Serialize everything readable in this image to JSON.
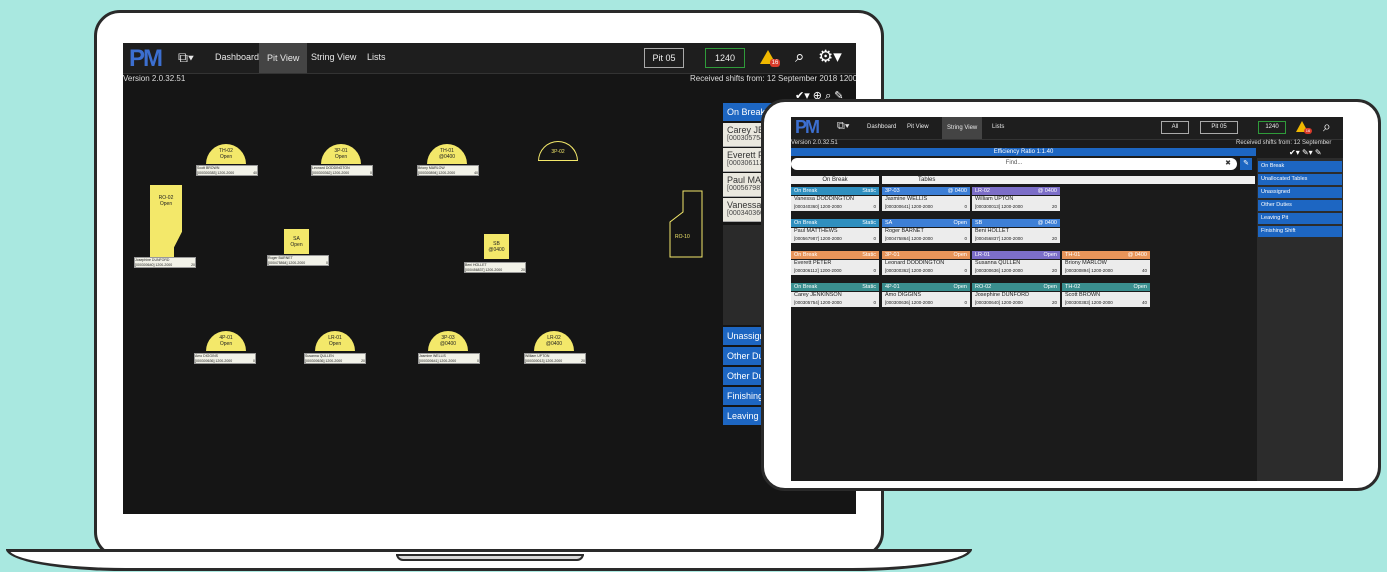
{
  "laptop": {
    "nav": {
      "logo": "PM",
      "dashboard": "Dashboard",
      "pit_view": "Pit View",
      "string_view": "String View",
      "lists": "Lists",
      "pit": "Pit 05",
      "count": "1240",
      "warn_badge": "16"
    },
    "version": "Version 2.0.32.51",
    "received": "Received shifts from: 12 September 2018 1200",
    "tables": [
      {
        "code": "TH-02",
        "status": "Open",
        "dealer": "Scott BROWN",
        "meta": "[000300383] 1200-2000",
        "num": "40"
      },
      {
        "code": "3P-01",
        "status": "Open",
        "dealer": "Leonard DODDINGTON",
        "meta": "[000300362] 1200-2000",
        "num": "0"
      },
      {
        "code": "TH-01",
        "status": "@0400",
        "dealer": "Briony MARLOW",
        "meta": "[000300894] 1200-2000",
        "num": "40"
      },
      {
        "code": "3P-02",
        "status": "",
        "dealer": "",
        "meta": "",
        "num": ""
      },
      {
        "code": "RO-02",
        "status": "Open",
        "dealer": "Josephine DUNFORD",
        "meta": "[000300640] 1200-2000",
        "num": "20"
      },
      {
        "code": "SA",
        "status": "Open",
        "dealer": "Roger BARNET",
        "meta": "[000475864] 1200-2000",
        "num": "0"
      },
      {
        "code": "SB",
        "status": "@0400",
        "dealer": "Beni HOLLET",
        "meta": "[000456837] 1200-2000",
        "num": "20"
      },
      {
        "code": "RO-10",
        "status": "",
        "dealer": "",
        "meta": "",
        "num": ""
      },
      {
        "code": "4P-01",
        "status": "Open",
        "dealer": "Amo DIGGINS",
        "meta": "[000300636] 1200-2000",
        "num": "0"
      },
      {
        "code": "LR-01",
        "status": "Open",
        "dealer": "Susanna QULLEN",
        "meta": "[000300636] 1200-2000",
        "num": "20"
      },
      {
        "code": "3P-03",
        "status": "@0400",
        "dealer": "Jasmine WELLIS",
        "meta": "[000300641] 1200-2000",
        "num": "0"
      },
      {
        "code": "LR-02",
        "status": "@0400",
        "dealer": "William UPTON",
        "meta": "[000300013] 1200-2000",
        "num": "20"
      }
    ],
    "panel": {
      "on_break": "On Break",
      "cards": [
        {
          "name": "Carey JE",
          "meta": "[000305754]"
        },
        {
          "name": "Everett P",
          "meta": "[000306112]"
        },
        {
          "name": "Paul MAT",
          "meta": "[000567987]"
        },
        {
          "name": "Vanessa",
          "meta": "[000340360]"
        }
      ],
      "buttons": [
        "Unassigned",
        "Other Duties",
        "Other Duties",
        "Finishing Shift",
        "Leaving Pit"
      ]
    }
  },
  "tablet": {
    "nav": {
      "logo": "PM",
      "dashboard": "Dashboard",
      "pit_view": "Pit View",
      "string_view": "String View",
      "lists": "Lists",
      "all": "All",
      "pit": "Pit 05",
      "count": "1240",
      "warn_badge": "16"
    },
    "version": "Version 2.0.32.51",
    "received": "Received shifts from: 12 September",
    "efficiency": "Efficiency Ratio 1:1.40",
    "find_placeholder": "Find...",
    "col_on_break": "On Break",
    "col_tables": "Tables",
    "rows": [
      [
        {
          "h": "On Break",
          "r": "Static",
          "c": "#2f8fbf",
          "n": "Vanessa DODDINGTON",
          "m": "[000340360] 1200-2000",
          "v": "0"
        },
        {
          "h": "3P-03",
          "r": "@ 0400",
          "c": "#3d7fd6",
          "n": "Jasmine WELLIS",
          "m": "[000300641] 1200-2000",
          "v": "0"
        },
        {
          "h": "LR-02",
          "r": "@ 0400",
          "c": "#7c6ec8",
          "n": "William UPTON",
          "m": "[000300013] 1200-2000",
          "v": "20"
        }
      ],
      [
        {
          "h": "On Break",
          "r": "Static",
          "c": "#2f8fbf",
          "n": "Paul MATTHEWS",
          "m": "[000567987] 1200-2000",
          "v": "0"
        },
        {
          "h": "SA",
          "r": "Open",
          "c": "#3d7fd6",
          "n": "Roger BARNET",
          "m": "[000475864] 1200-2000",
          "v": "0"
        },
        {
          "h": "SB",
          "r": "@ 0400",
          "c": "#3d7fd6",
          "n": "Beni HOLLET",
          "m": "[000456837] 1200-2000",
          "v": "20"
        }
      ],
      [
        {
          "h": "On Break",
          "r": "Static",
          "c": "#e8955a",
          "n": "Everett PETER",
          "m": "[000306112] 1200-2000",
          "v": "0"
        },
        {
          "h": "3P-01",
          "r": "Open",
          "c": "#e8955a",
          "n": "Leonard DODDINGTON",
          "m": "[000300362] 1200-2000",
          "v": "0"
        },
        {
          "h": "LR-01",
          "r": "Open",
          "c": "#7c6ec8",
          "n": "Susanna QULLEN",
          "m": "[000300636] 1200-2000",
          "v": "20"
        },
        {
          "h": "TH-01",
          "r": "@ 0400",
          "c": "#e8955a",
          "n": "Briony MARLOW",
          "m": "[000300894] 1200-2000",
          "v": "40"
        }
      ],
      [
        {
          "h": "On Break",
          "r": "Static",
          "c": "#3a8f8f",
          "n": "Carey JENKINSON",
          "m": "[000305754] 1200-2000",
          "v": "0"
        },
        {
          "h": "4P-01",
          "r": "Open",
          "c": "#3a8f8f",
          "n": "Amo DIGGINS",
          "m": "[000300636] 1200-2000",
          "v": "0"
        },
        {
          "h": "RO-02",
          "r": "Open",
          "c": "#3a8f8f",
          "n": "Josephine DUNFORD",
          "m": "[000300640] 1200-2000",
          "v": "20"
        },
        {
          "h": "TH-02",
          "r": "Open",
          "c": "#3a8f8f",
          "n": "Scott BROWN",
          "m": "[000300383] 1200-2000",
          "v": "40"
        }
      ]
    ],
    "sidebar": [
      "On Break",
      "Unallocated Tables",
      "Unassigned",
      "Other Duties",
      "Leaving Pit",
      "Finishing Shift"
    ]
  }
}
